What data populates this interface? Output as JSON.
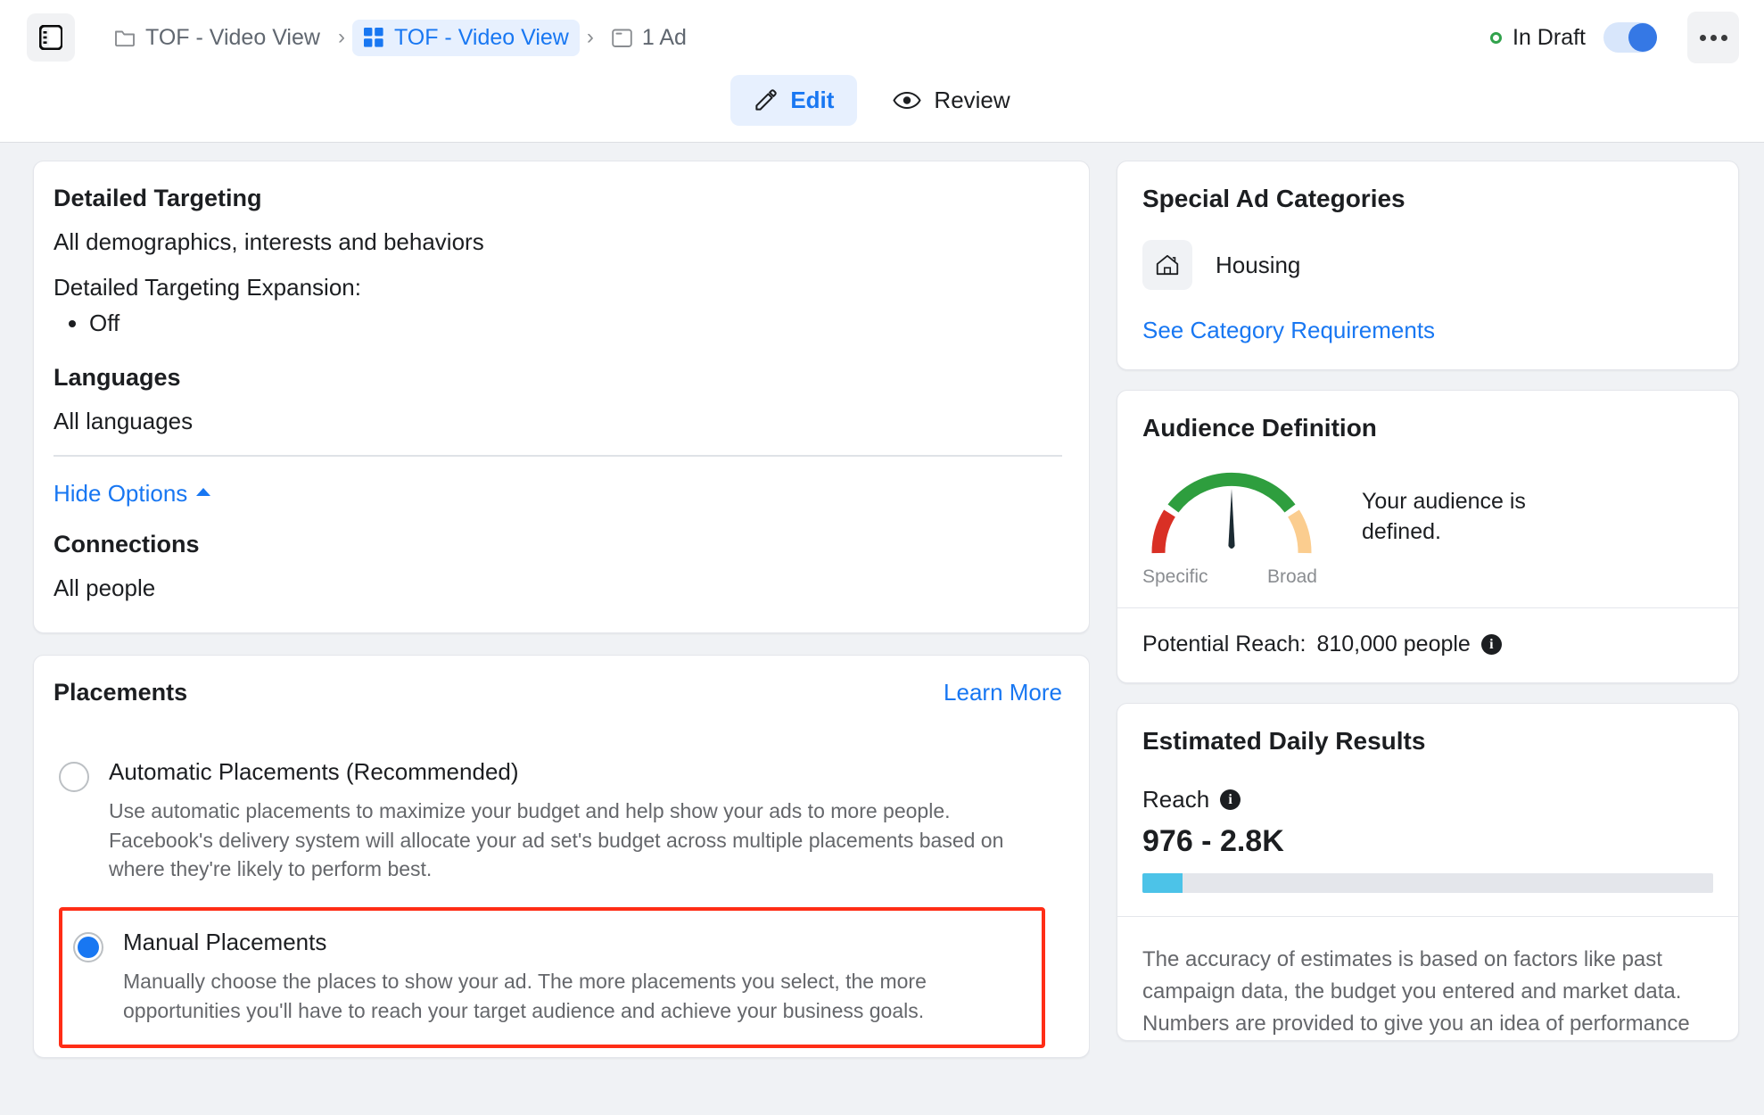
{
  "topbar": {
    "sidebar_toggle_icon": "panel-layout-icon",
    "breadcrumb": [
      {
        "label": "TOF - Video View",
        "icon": "folder-icon",
        "active": false
      },
      {
        "label": "TOF - Video View",
        "icon": "grid-icon",
        "active": true
      },
      {
        "label": "1 Ad",
        "icon": "ad-window-icon",
        "active": false
      }
    ],
    "separator": "›",
    "status_label": "In Draft",
    "status_color": "#31a24c",
    "toggle_state": "on",
    "more_icon": "ellipsis-icon"
  },
  "tabs": [
    {
      "label": "Edit",
      "icon": "pencil-icon",
      "active": true
    },
    {
      "label": "Review",
      "icon": "eye-icon",
      "active": false
    }
  ],
  "targeting": {
    "detailed_title": "Detailed Targeting",
    "detailed_value": "All demographics, interests and behaviors",
    "expansion_label": "Detailed Targeting Expansion:",
    "expansion_value": "Off",
    "languages_title": "Languages",
    "languages_value": "All languages",
    "hide_options": "Hide Options",
    "connections_title": "Connections",
    "connections_value": "All people"
  },
  "placements": {
    "title": "Placements",
    "learn_more": "Learn More",
    "automatic": {
      "label": "Automatic Placements (Recommended)",
      "desc": "Use automatic placements to maximize your budget and help show your ads to more people. Facebook's delivery system will allocate your ad set's budget across multiple placements based on where they're likely to perform best.",
      "selected": false
    },
    "manual": {
      "label": "Manual Placements",
      "desc": "Manually choose the places to show your ad. The more placements you select, the more opportunities you'll have to reach your target audience and achieve your business goals.",
      "selected": true,
      "highlight_color": "#ff2d16"
    }
  },
  "special_ad_categories": {
    "title": "Special Ad Categories",
    "category_label": "Housing",
    "category_icon": "house-icon",
    "link": "See Category Requirements"
  },
  "audience_definition": {
    "title": "Audience Definition",
    "note": "Your audience is defined.",
    "gauge_low_label": "Specific",
    "gauge_high_label": "Broad",
    "gauge_needle_angle_deg": -3,
    "gauge_colors": {
      "low": "#d93025",
      "mid": "#2e9e3e",
      "high": "#fbcd8f"
    },
    "reach_label": "Potential Reach:",
    "reach_value": "810,000 people",
    "reach_info_icon": "info-icon"
  },
  "estimated_daily_results": {
    "title": "Estimated Daily Results",
    "metric_label": "Reach",
    "metric_info_icon": "info-icon",
    "metric_value": "976 - 2.8K",
    "progress_percent": 7,
    "progress_color": "#4cc3e8",
    "accuracy_note": "The accuracy of estimates is based on factors like past campaign data, the budget you entered and market data. Numbers are provided to give you an idea of performance"
  }
}
